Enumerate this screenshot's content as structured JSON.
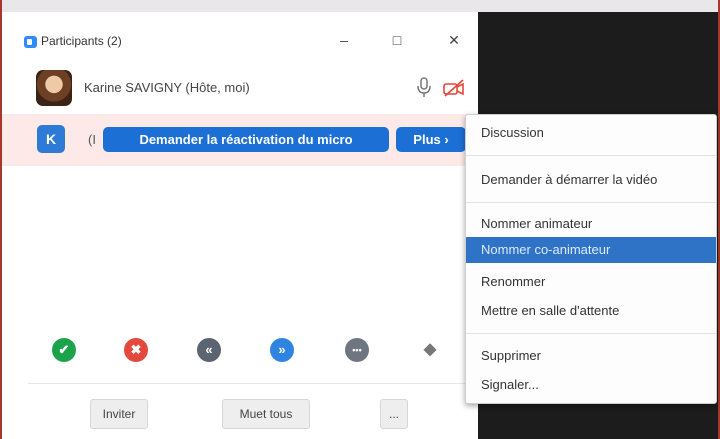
{
  "window": {
    "title": "Participants (2)",
    "minimize": "–",
    "maximize": "□",
    "close": "✕"
  },
  "participants": [
    {
      "name": "Karine SAVIGNY (Hôte, moi)",
      "icons": [
        "microphone-icon",
        "video-off-icon"
      ]
    },
    {
      "initial": "K",
      "name_visible": "(I"
    }
  ],
  "row_actions": {
    "unmute_request": "Demander la réactivation du micro",
    "more": "Plus ›"
  },
  "reactions": [
    {
      "icon": "yes-icon",
      "symbol": "✔",
      "color": "#1aa34a"
    },
    {
      "icon": "no-icon",
      "symbol": "✖",
      "color": "#e4473c"
    },
    {
      "icon": "slower-icon",
      "symbol": "«",
      "color": "#5b6470"
    },
    {
      "icon": "faster-icon",
      "symbol": "»",
      "color": "#2e84e0"
    },
    {
      "icon": "more-reactions-icon",
      "symbol": "•••",
      "color": "#6f7682"
    },
    {
      "icon": "clear-all-icon",
      "symbol": "◆",
      "color": "#777777"
    }
  ],
  "footer": {
    "invite": "Inviter",
    "mute_all": "Muet tous",
    "more": "..."
  },
  "context_menu": {
    "items": [
      "Discussion",
      "Demander à démarrer la vidéo",
      "Nommer animateur",
      "Nommer co-animateur",
      "Renommer",
      "Mettre en salle d'attente",
      "Supprimer",
      "Signaler..."
    ],
    "highlighted": "Nommer co-animateur"
  },
  "colors": {
    "accent": "#1c6fd4",
    "row_highlight": "#fdeae8",
    "menu_highlight": "#2f73c7",
    "border": "#a5382a"
  }
}
